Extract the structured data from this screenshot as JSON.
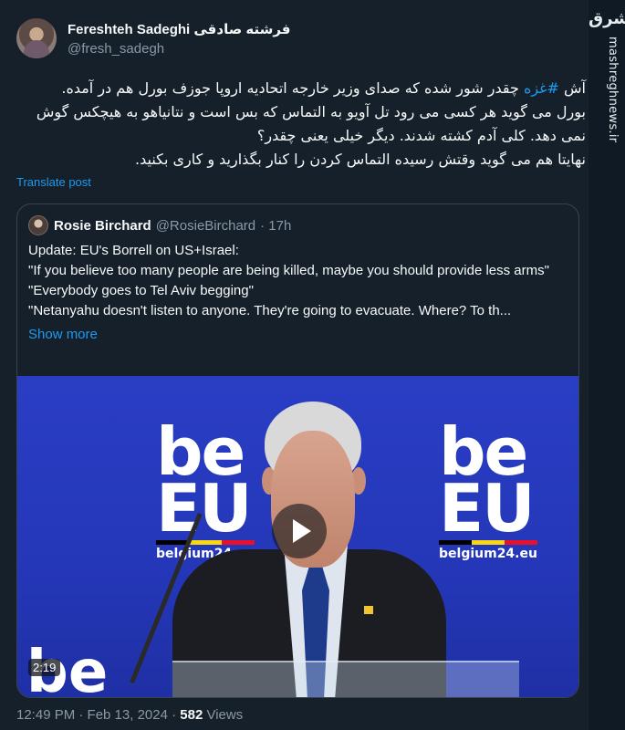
{
  "watermark": {
    "logo": "مشرق",
    "site": "mashreghnews.ir"
  },
  "author": {
    "name": "Fereshteh Sadeghi فرشته صادقی",
    "handle": "@fresh_sadegh"
  },
  "post": {
    "prefix": "آش ",
    "hashtag": "#غزه",
    "text_1": " چقدر شور شده که صدای وزیر خارجه اتحادیه اروپا جوزف بورل هم در آمده. بورل می گوید هر کسی می رود تل آویو به التماس که بس است و نتانیاهو به هیچکس گوش نمی دهد. کلی آدم کشته شدند. دیگر خیلی یعنی چقدر؟",
    "text_2": "نهایتا هم می  گوید وقتش رسیده التماس کردن را کنار بگذارید و کاری بکنید.",
    "translate_label": "Translate post"
  },
  "quote": {
    "name": "Rosie Birchard",
    "handle": "@RosieBirchard",
    "time": "· 17h",
    "lines": [
      "Update: EU's Borrell on US+Israel:",
      "\"If you believe too many people are being killed, maybe you should provide less arms\"",
      "\"Everybody goes to Tel Aviv begging\"",
      "\"Netanyahu doesn't listen to anyone. They're going to evacuate. Where? To th..."
    ],
    "show_more": "Show more",
    "video": {
      "be_word": "be",
      "eu_word": "EU",
      "site": "belgium24.eu",
      "duration": "2:19"
    }
  },
  "footer": {
    "timestamp": "12:49 PM · Feb 13, 2024 · ",
    "views_count": "582",
    "views_label": " Views"
  }
}
